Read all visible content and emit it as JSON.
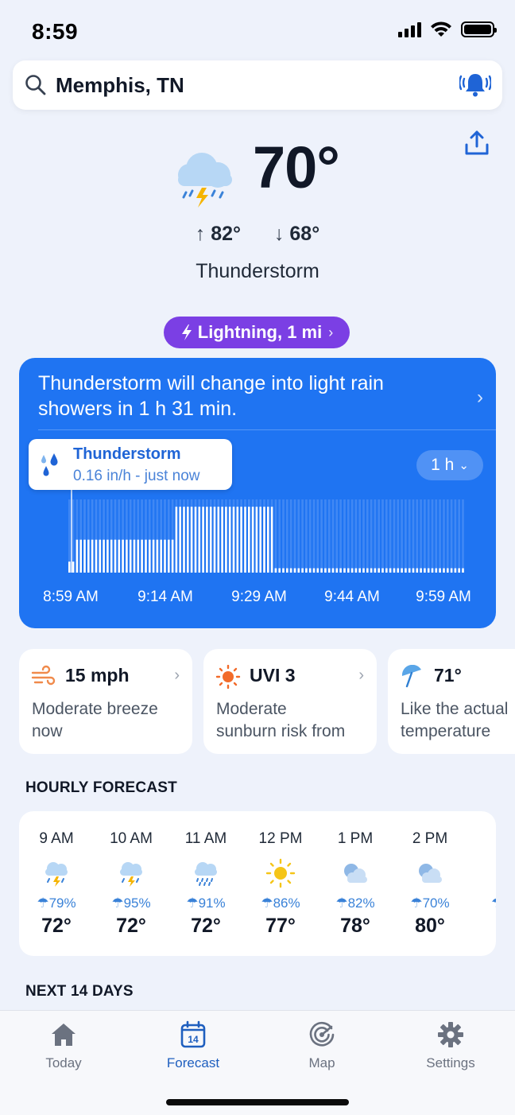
{
  "status_bar": {
    "time": "8:59"
  },
  "search": {
    "location": "Memphis, TN"
  },
  "current": {
    "temperature": "70°",
    "high": "82°",
    "low": "68°",
    "high_arrow": "↑",
    "low_arrow": "↓",
    "condition": "Thunderstorm",
    "icon": "thunderstorm-cloud-icon"
  },
  "lightning_alert": {
    "label": "Lightning, 1 mi",
    "chevron": "›"
  },
  "nowcast": {
    "message": "Thunderstorm will change into light rain showers in 1 h 31 min.",
    "tooltip_title": "Thunderstorm",
    "tooltip_subtitle": "0.16 in/h - just now",
    "range_label": "1 h",
    "x_labels": [
      "8:59 AM",
      "9:14 AM",
      "9:29 AM",
      "9:44 AM",
      "9:59 AM"
    ],
    "colors": {
      "background": "#1f74f2",
      "bar": "#ffffff"
    }
  },
  "chart_data": {
    "type": "bar",
    "x_start": "8:59 AM",
    "x_end": "9:59 AM",
    "categories": [
      "8:59 AM",
      "9:14 AM",
      "9:29 AM",
      "9:44 AM",
      "9:59 AM"
    ],
    "segments": [
      {
        "count": 2,
        "level": 0.15
      },
      {
        "count": 26,
        "level": 0.45
      },
      {
        "count": 26,
        "level": 0.9
      },
      {
        "count": 50,
        "level": 0.06
      }
    ]
  },
  "cards": [
    {
      "icon": "wind-icon",
      "value": "15 mph",
      "desc_line1": "Moderate breeze",
      "desc_line2": "now",
      "chevron": "›"
    },
    {
      "icon": "sun-icon",
      "value": "UVI 3",
      "desc_line1": "Moderate",
      "desc_line2": "sunburn risk from",
      "chevron": "›"
    },
    {
      "icon": "umbrella-icon",
      "value": "71°",
      "desc_line1": "Like the actual",
      "desc_line2": "temperature",
      "chevron": ""
    }
  ],
  "hourly": {
    "title": "HOURLY FORECAST",
    "hours": [
      {
        "time": "9 AM",
        "icon": "thunderstorm-icon",
        "precip": "79%",
        "temp": "72°"
      },
      {
        "time": "10 AM",
        "icon": "thunderstorm-icon",
        "precip": "95%",
        "temp": "72°"
      },
      {
        "time": "11 AM",
        "icon": "rain-icon",
        "precip": "91%",
        "temp": "72°"
      },
      {
        "time": "12 PM",
        "icon": "sun-icon",
        "precip": "86%",
        "temp": "77°"
      },
      {
        "time": "1 PM",
        "icon": "cloudy-icon",
        "precip": "82%",
        "temp": "78°"
      },
      {
        "time": "2 PM",
        "icon": "cloudy-icon",
        "precip": "70%",
        "temp": "80°"
      }
    ],
    "precip_prefix": "☂"
  },
  "next_days": {
    "title": "NEXT 14 DAYS"
  },
  "tabs": [
    {
      "label": "Today",
      "icon": "home-icon",
      "active": false
    },
    {
      "label": "Forecast",
      "icon": "calendar-icon",
      "active": true,
      "badge": "14"
    },
    {
      "label": "Map",
      "icon": "radar-icon",
      "active": false
    },
    {
      "label": "Settings",
      "icon": "gear-icon",
      "active": false
    }
  ],
  "colors": {
    "accent": "#1f74f2",
    "lightning_pill": "#7b3fe4",
    "active_tab": "#1f5fbf",
    "precip_text": "#3a82d8"
  }
}
